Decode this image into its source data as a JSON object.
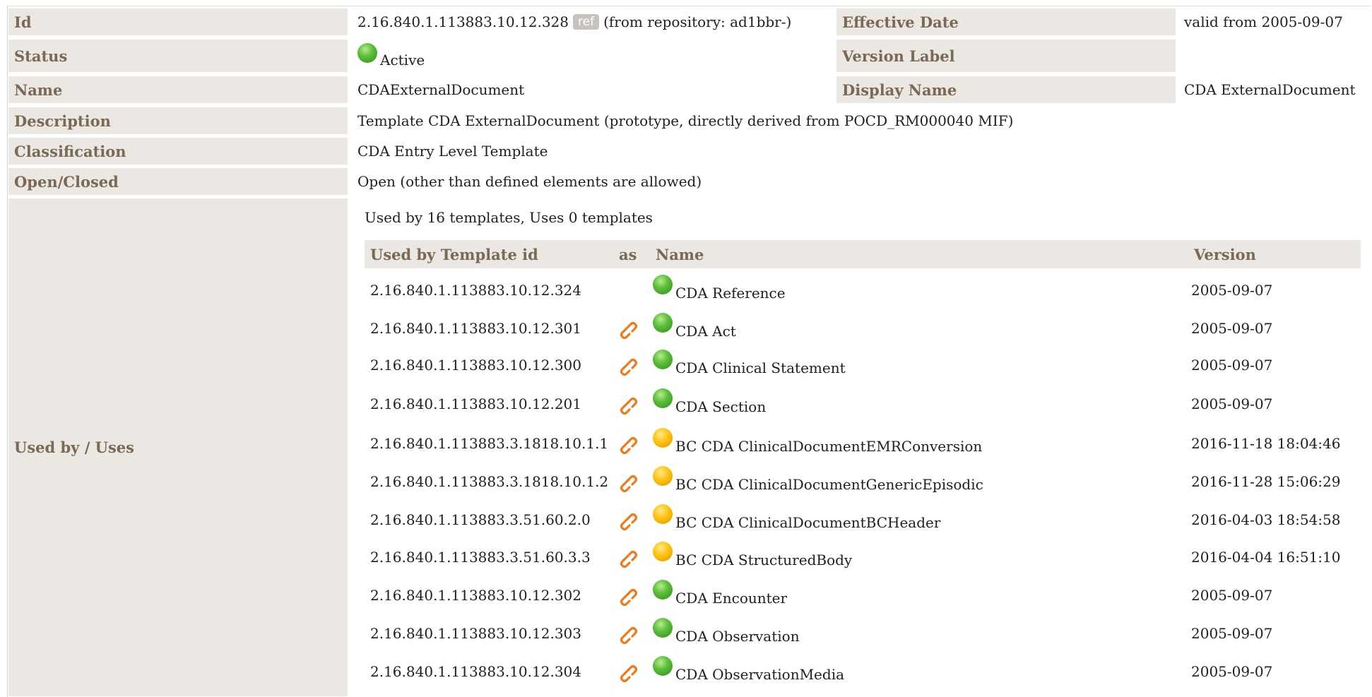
{
  "fields": {
    "id_label": "Id",
    "id_value": "2.16.840.1.113883.10.12.328",
    "ref_badge": "ref",
    "id_repo": "(from repository: ad1bbr-)",
    "effective_label": "Effective Date",
    "effective_value": "valid from 2005-09-07",
    "status_label": "Status",
    "status_value": "Active",
    "version_label": "Version Label",
    "version_value": "",
    "name_label": "Name",
    "name_value": "CDAExternalDocument",
    "display_label": "Display Name",
    "display_value": "CDA ExternalDocument",
    "description_label": "Description",
    "description_value": "Template CDA ExternalDocument (prototype, directly derived from POCD_RM000040 MIF)",
    "classification_label": "Classification",
    "classification_value": "CDA Entry Level Template",
    "openclosed_label": "Open/Closed",
    "openclosed_value": "Open (other than defined elements are allowed)",
    "usedby_label": "Used by / Uses"
  },
  "usage": {
    "summary": "Used by 16 templates, Uses 0 templates",
    "headers": {
      "id": "Used by Template id",
      "as": "as",
      "name": "Name",
      "version": "Version"
    },
    "rows": [
      {
        "id": "2.16.840.1.113883.10.12.324",
        "link": false,
        "status": "green",
        "name": "CDA Reference",
        "version": "2005-09-07"
      },
      {
        "id": "2.16.840.1.113883.10.12.301",
        "link": true,
        "status": "green",
        "name": "CDA Act",
        "version": "2005-09-07"
      },
      {
        "id": "2.16.840.1.113883.10.12.300",
        "link": true,
        "status": "green",
        "name": "CDA Clinical Statement",
        "version": "2005-09-07"
      },
      {
        "id": "2.16.840.1.113883.10.12.201",
        "link": true,
        "status": "green",
        "name": "CDA Section",
        "version": "2005-09-07"
      },
      {
        "id": "2.16.840.1.113883.3.1818.10.1.1",
        "link": true,
        "status": "yellow",
        "name": "BC CDA ClinicalDocumentEMRConversion",
        "version": "2016-11-18 18:04:46"
      },
      {
        "id": "2.16.840.1.113883.3.1818.10.1.2",
        "link": true,
        "status": "yellow",
        "name": "BC CDA ClinicalDocumentGenericEpisodic",
        "version": "2016-11-28 15:06:29"
      },
      {
        "id": "2.16.840.1.113883.3.51.60.2.0",
        "link": true,
        "status": "yellow",
        "name": "BC CDA ClinicalDocumentBCHeader",
        "version": "2016-04-03 18:54:58"
      },
      {
        "id": "2.16.840.1.113883.3.51.60.3.3",
        "link": true,
        "status": "yellow",
        "name": "BC CDA StructuredBody",
        "version": "2016-04-04 16:51:10"
      },
      {
        "id": "2.16.840.1.113883.10.12.302",
        "link": true,
        "status": "green",
        "name": "CDA Encounter",
        "version": "2005-09-07"
      },
      {
        "id": "2.16.840.1.113883.10.12.303",
        "link": true,
        "status": "green",
        "name": "CDA Observation",
        "version": "2005-09-07"
      },
      {
        "id": "2.16.840.1.113883.10.12.304",
        "link": true,
        "status": "green",
        "name": "CDA ObservationMedia",
        "version": "2005-09-07"
      }
    ]
  },
  "colors": {
    "label_bg": "#ebe8e3",
    "label_text": "#7a6a55",
    "status_green": "#5cc03a",
    "status_yellow": "#ffc20e",
    "link_icon": "#f07a1a"
  },
  "icons": {
    "status": "status-ball-icon",
    "link": "chain-link-icon"
  }
}
